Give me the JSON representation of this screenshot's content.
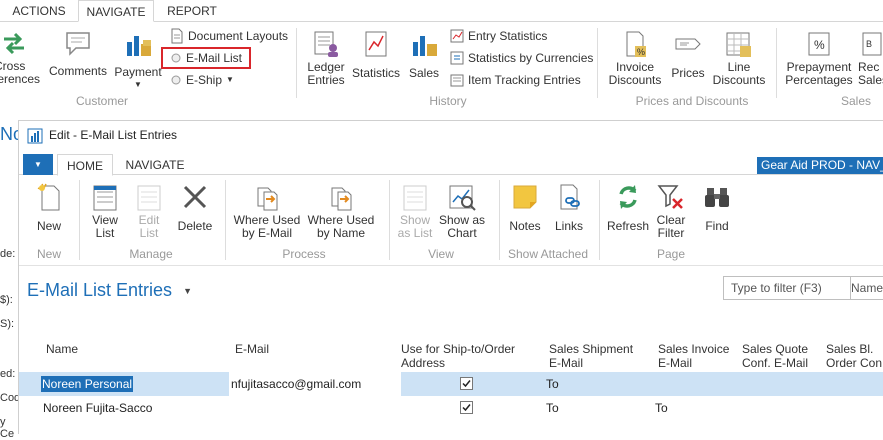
{
  "bg_tabs": [
    "ACTIONS",
    "NAVIGATE",
    "REPORT"
  ],
  "bg_ribbon": {
    "left_partial": "Cross\nferences",
    "comments": "Comments",
    "payment": "Payment",
    "document_layouts": "Document Layouts",
    "email_list": "E-Mail List",
    "e_ship": "E-Ship",
    "group_customer": "Customer",
    "ledger_entries": "Ledger\nEntries",
    "statistics": "Statistics",
    "sales": "Sales",
    "entry_statistics": "Entry Statistics",
    "statistics_by_currencies": "Statistics by Currencies",
    "item_tracking_entries": "Item Tracking Entries",
    "group_history": "History",
    "invoice_discounts": "Invoice\nDiscounts",
    "prices": "Prices",
    "line_discounts": "Line\nDiscounts",
    "group_prices": "Prices and Discounts",
    "prepayment_percentages": "Prepayment\nPercentages",
    "rec_sales_partial": "Rec\nSales",
    "group_sales": "Sales"
  },
  "bg_left_fragments": [
    "No",
    "de:",
    "$):",
    "S):",
    "ed:",
    "Cod",
    "y Ce"
  ],
  "dialog": {
    "title": "Edit - E-Mail List Entries",
    "tabs": [
      "HOME",
      "NAVIGATE"
    ],
    "company": "Gear Aid PROD - NAV_C",
    "ribbon": {
      "new": "New",
      "view_list": "View\nList",
      "edit_list": "Edit\nList",
      "delete": "Delete",
      "where_used_email": "Where Used\nby E-Mail",
      "where_used_name": "Where Used\nby Name",
      "show_as_list": "Show\nas List",
      "show_as_chart": "Show as\nChart",
      "notes": "Notes",
      "links": "Links",
      "refresh": "Refresh",
      "clear_filter": "Clear\nFilter",
      "find": "Find",
      "groups": {
        "new": "New",
        "manage": "Manage",
        "process": "Process",
        "view": "View",
        "show_attached": "Show Attached",
        "page": "Page"
      }
    },
    "page_title": "E-Mail List Entries",
    "filter_placeholder": "Type to filter (F3)",
    "filter_column": "Name",
    "columns": [
      "Name",
      "E-Mail",
      "Use for Ship-to/Order\nAddress",
      "Sales Shipment\nE-Mail",
      "Sales Invoice\nE-Mail",
      "Sales Quote\nConf. E-Mail",
      "Sales Bl.\nOrder Con."
    ],
    "rows": [
      {
        "name": "Noreen Personal",
        "email": "nfujitasacco@gmail.com",
        "use_ship_to": true,
        "sales_shipment": "To",
        "sales_invoice": "",
        "sales_quote": "",
        "sales_bl": ""
      },
      {
        "name": "Noreen Fujita-Sacco",
        "email": "",
        "use_ship_to": true,
        "sales_shipment": "To",
        "sales_invoice": "To",
        "sales_quote": "",
        "sales_bl": ""
      }
    ]
  },
  "colors": {
    "accent": "#1e6fb7",
    "selected_row": "#cde2f5",
    "highlight_border": "#d9262b",
    "orange_icon": "#e38a1f",
    "green_icon": "#3a9a5b"
  }
}
